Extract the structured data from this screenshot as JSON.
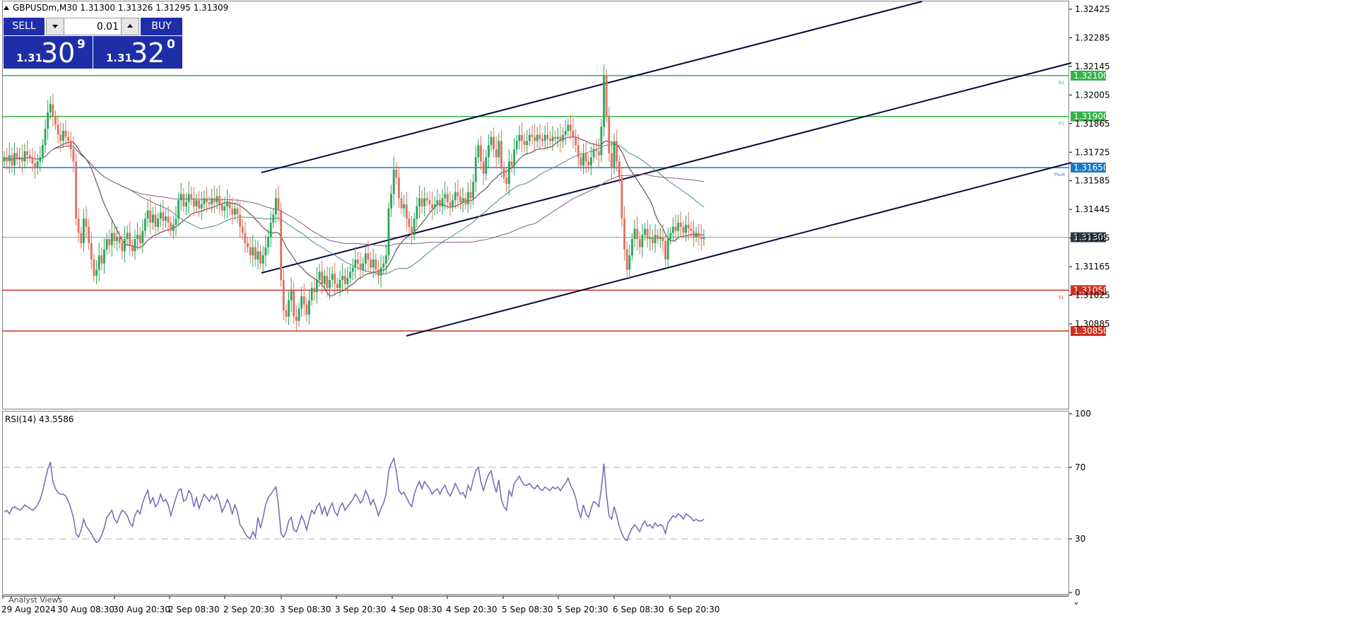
{
  "header": {
    "title": "GBPUSDm,M30  1.31300 1.31326 1.31295 1.31309"
  },
  "trade_panel": {
    "sell_label": "SELL",
    "buy_label": "BUY",
    "volume": "0.01",
    "sell_quote": {
      "prefix": "1.31",
      "big": "30",
      "sup": "9"
    },
    "buy_quote": {
      "prefix": "1.31",
      "big": "32",
      "sup": "0"
    },
    "button_color": "#1f2ea8"
  },
  "price_scale": {
    "ticks": [
      "1.32425",
      "1.32285",
      "1.32145",
      "1.32005",
      "1.31865",
      "1.31725",
      "1.31585",
      "1.31445",
      "1.31305",
      "1.31165",
      "1.31025",
      "1.30885"
    ]
  },
  "levels": [
    {
      "price": "1.32100",
      "tag": "R2",
      "color": "#36b24a"
    },
    {
      "price": "1.31900",
      "tag": "R1",
      "color": "#36b24a"
    },
    {
      "price": "1.31650",
      "tag": "Pivot",
      "color": "#1a78c2"
    },
    {
      "price": "1.31309",
      "tag": "",
      "color": "#2b3a45"
    },
    {
      "price": "1.31050",
      "tag": "S1",
      "color": "#d0301f"
    },
    {
      "price": "1.30850",
      "tag": "",
      "color": "#d0301f"
    }
  ],
  "rsi": {
    "label": "RSI(14) 43.5586",
    "scale": [
      "100",
      "70",
      "30",
      "0"
    ]
  },
  "time_axis": {
    "labels": [
      "29 Aug 2024",
      "30 Aug 08:30",
      "30 Aug 20:30",
      "2 Sep 08:30",
      "2 Sep 20:30",
      "3 Sep 08:30",
      "3 Sep 20:30",
      "4 Sep 08:30",
      "4 Sep 20:30",
      "5 Sep 08:30",
      "5 Sep 20:30",
      "6 Sep 08:30",
      "6 Sep 20:30"
    ]
  },
  "bottom_tab": {
    "label": "Analyst Views"
  },
  "chart_data": {
    "type": "candlestick",
    "symbol": "GBPUSDm",
    "timeframe": "M30",
    "ylim": [
      1.308,
      1.3246
    ],
    "closes": [
      1.317,
      1.3168,
      1.3171,
      1.3166,
      1.3172,
      1.3169,
      1.317,
      1.3168,
      1.3173,
      1.3171,
      1.317,
      1.3167,
      1.3165,
      1.3168,
      1.317,
      1.3176,
      1.3184,
      1.3192,
      1.3196,
      1.319,
      1.3186,
      1.3181,
      1.3178,
      1.3183,
      1.318,
      1.3178,
      1.3174,
      1.3168,
      1.314,
      1.3133,
      1.3128,
      1.314,
      1.3136,
      1.3128,
      1.312,
      1.3112,
      1.3115,
      1.3122,
      1.3118,
      1.3125,
      1.313,
      1.3127,
      1.3133,
      1.3129,
      1.3131,
      1.3128,
      1.3124,
      1.313,
      1.3133,
      1.3127,
      1.3124,
      1.313,
      1.3132,
      1.3128,
      1.3134,
      1.314,
      1.3144,
      1.3138,
      1.3142,
      1.3136,
      1.314,
      1.3143,
      1.3139,
      1.3141,
      1.3138,
      1.3134,
      1.3137,
      1.314,
      1.3149,
      1.3152,
      1.3146,
      1.3148,
      1.3152,
      1.315,
      1.3146,
      1.3149,
      1.3145,
      1.3147,
      1.315,
      1.3148,
      1.3147,
      1.315,
      1.3148,
      1.3151,
      1.3147,
      1.3144,
      1.3146,
      1.3148,
      1.3145,
      1.3142,
      1.3145,
      1.3142,
      1.3136,
      1.3133,
      1.3128,
      1.3126,
      1.3122,
      1.3126,
      1.312,
      1.3124,
      1.3118,
      1.3122,
      1.3126,
      1.3131,
      1.3138,
      1.3142,
      1.315,
      1.3144,
      1.311,
      1.3095,
      1.3092,
      1.31,
      1.3105,
      1.3092,
      1.309,
      1.3096,
      1.3102,
      1.3098,
      1.3093,
      1.31,
      1.3106,
      1.3104,
      1.311,
      1.3114,
      1.3108,
      1.3112,
      1.3106,
      1.311,
      1.3113,
      1.3108,
      1.3106,
      1.311,
      1.3112,
      1.3108,
      1.3111,
      1.3114,
      1.3116,
      1.312,
      1.3118,
      1.3115,
      1.3118,
      1.3123,
      1.312,
      1.3116,
      1.312,
      1.3115,
      1.3112,
      1.3116,
      1.3118,
      1.3122,
      1.3145,
      1.3152,
      1.3164,
      1.316,
      1.315,
      1.3145,
      1.3147,
      1.314,
      1.3136,
      1.3132,
      1.314,
      1.3146,
      1.315,
      1.3146,
      1.315,
      1.3149,
      1.3147,
      1.3145,
      1.3147,
      1.3149,
      1.3146,
      1.315,
      1.3152,
      1.3148,
      1.3146,
      1.3149,
      1.3153,
      1.3151,
      1.3148,
      1.315,
      1.3147,
      1.3153,
      1.315,
      1.3158,
      1.317,
      1.3176,
      1.3168,
      1.3162,
      1.317,
      1.3176,
      1.318,
      1.3174,
      1.317,
      1.3178,
      1.3165,
      1.316,
      1.3157,
      1.3168,
      1.3166,
      1.3174,
      1.3178,
      1.3181,
      1.3178,
      1.3176,
      1.3178,
      1.3181,
      1.318,
      1.3178,
      1.3181,
      1.3179,
      1.3178,
      1.3181,
      1.3179,
      1.3178,
      1.318,
      1.3179,
      1.318,
      1.3178,
      1.3181,
      1.3183,
      1.3186,
      1.3183,
      1.318,
      1.3176,
      1.317,
      1.3166,
      1.3172,
      1.3168,
      1.3166,
      1.317,
      1.3174,
      1.3173,
      1.3171,
      1.3185,
      1.321,
      1.319,
      1.3172,
      1.3165,
      1.3178,
      1.3168,
      1.316,
      1.314,
      1.3125,
      1.3115,
      1.3122,
      1.313,
      1.3135,
      1.313,
      1.3126,
      1.3132,
      1.3135,
      1.313,
      1.3131,
      1.3128,
      1.3132,
      1.313,
      1.3131,
      1.3129,
      1.312,
      1.313,
      1.3133,
      1.3136,
      1.3134,
      1.3138,
      1.3136,
      1.3133,
      1.3137,
      1.3135,
      1.3134,
      1.3131,
      1.3133,
      1.3131,
      1.313,
      1.3131
    ],
    "rsi_values": [
      45,
      46,
      44,
      47,
      48,
      47,
      46,
      47,
      49,
      48,
      47,
      46,
      47,
      49,
      52,
      57,
      63,
      69,
      73,
      62,
      58,
      56,
      55,
      55,
      54,
      51,
      47,
      42,
      33,
      31,
      35,
      41,
      37,
      35,
      33,
      30,
      28,
      29,
      32,
      36,
      42,
      44,
      46,
      41,
      39,
      43,
      46,
      45,
      43,
      39,
      37,
      43,
      46,
      44,
      50,
      54,
      57,
      50,
      53,
      48,
      50,
      55,
      51,
      52,
      49,
      43,
      48,
      53,
      57,
      58,
      51,
      52,
      57,
      55,
      48,
      53,
      47,
      51,
      55,
      53,
      51,
      54,
      52,
      55,
      51,
      45,
      48,
      52,
      49,
      44,
      49,
      45,
      38,
      36,
      33,
      31,
      30,
      34,
      31,
      42,
      36,
      42,
      49,
      53,
      55,
      57,
      59,
      49,
      33,
      31,
      34,
      40,
      42,
      35,
      34,
      38,
      43,
      40,
      35,
      41,
      46,
      44,
      48,
      50,
      44,
      48,
      43,
      47,
      50,
      45,
      43,
      48,
      50,
      46,
      48,
      50,
      52,
      55,
      53,
      50,
      52,
      57,
      54,
      49,
      52,
      48,
      43,
      47,
      50,
      55,
      68,
      72,
      75,
      68,
      57,
      55,
      56,
      53,
      50,
      48,
      55,
      59,
      62,
      58,
      62,
      60,
      58,
      55,
      57,
      58,
      55,
      58,
      60,
      56,
      54,
      57,
      61,
      58,
      55,
      56,
      53,
      60,
      57,
      63,
      68,
      70,
      62,
      57,
      62,
      66,
      68,
      61,
      56,
      63,
      52,
      48,
      46,
      57,
      54,
      61,
      63,
      65,
      62,
      60,
      60,
      61,
      59,
      58,
      60,
      58,
      57,
      59,
      58,
      57,
      59,
      58,
      59,
      57,
      59,
      61,
      64,
      60,
      57,
      53,
      46,
      42,
      49,
      44,
      42,
      47,
      51,
      50,
      48,
      58,
      72,
      55,
      43,
      41,
      48,
      43,
      37,
      33,
      30,
      29,
      33,
      36,
      38,
      36,
      34,
      38,
      40,
      37,
      38,
      36,
      39,
      37,
      38,
      37,
      33,
      39,
      41,
      43,
      42,
      44,
      43,
      41,
      44,
      43,
      42,
      40,
      41,
      40,
      40,
      41
    ],
    "rsi_ylim": [
      0,
      100
    ],
    "rsi_levels": [
      70,
      30
    ]
  }
}
